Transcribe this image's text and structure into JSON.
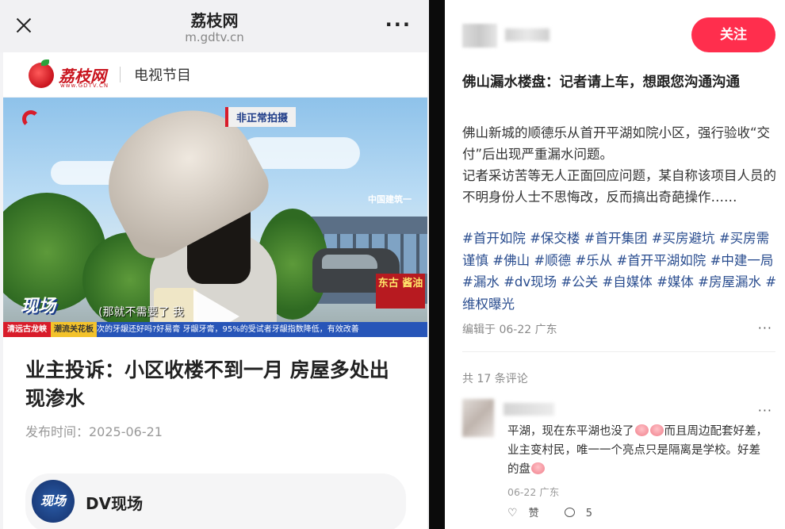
{
  "phone": {
    "site_title": "荔枝网",
    "site_url": "m.gdtv.cn",
    "brand_logo_text": "荔枝网",
    "brand_logo_sub": "www.GDTV.CN",
    "section_label": "电视节目",
    "video": {
      "badge": "非正常拍摄",
      "show_logo": "现场",
      "subtitle": "(那就不需要了 我",
      "ad_text": "东古 酱油",
      "building_sign": "中国建筑一",
      "ticker_location": "清远古龙峡",
      "ticker_tag": "潮流关花板",
      "ticker_text": "次的牙龈还好吗?好易膏 牙龈牙膏，95%的受试者牙龈指数降低，有效改善"
    },
    "article": {
      "title": "业主投诉：小区收楼不到一月 房屋多处出现渗水",
      "publish_label": "发布时间：2025-06-21"
    },
    "channel": {
      "avatar_text": "现场",
      "name": "DV现场"
    }
  },
  "post": {
    "follow_label": "关注",
    "title": "佛山漏水楼盘：记者请上车，想跟您沟通沟通",
    "body": [
      "佛山新城的顺德乐从首开平湖如院小区，强行验收“交付”后出现严重漏水问题。",
      "记者采访苦等无人正面回应问题，某自称该项目人员的不明身份人士不思悔改，反而搞出奇葩操作……"
    ],
    "tags": [
      "#首开如院",
      "#保交楼",
      "#首开集团",
      "#买房避坑",
      "#买房需谨慎",
      "#佛山",
      "#顺德",
      "#乐从",
      "#首开平湖如院",
      "#中建一局",
      "#漏水",
      "#dv现场",
      "#公关",
      "#自媒体",
      "#媒体",
      "#房屋漏水",
      "#维权曝光"
    ],
    "edit_meta": "编辑于 06-22 广东",
    "more": "···"
  },
  "comments": {
    "count_label": "共 17 条评论",
    "items": [
      {
        "text_a": "平湖，现在东平湖也没了",
        "text_b": "而且周边配套好差，业主变村民，唯一一个亮点只是隔离是学校。好差的盘",
        "meta": "06-22 广东",
        "like_label": "赞",
        "reply_count": "5",
        "more": "···"
      }
    ]
  }
}
